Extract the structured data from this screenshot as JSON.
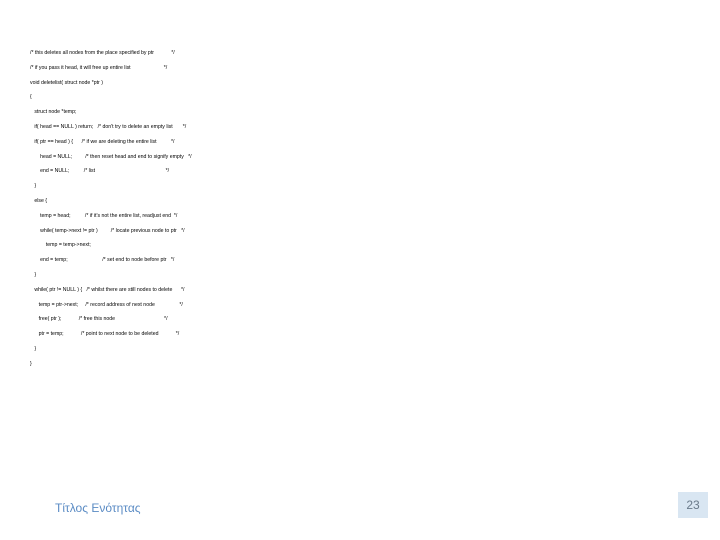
{
  "code": {
    "l1": "/* this deletes all nodes from the place specified by ptr            */",
    "l2": "/* if you pass it head, it will free up entire list                       */",
    "l3": "void deletelist( struct node *ptr )",
    "l4": "{",
    "l5": "   struct node *temp;",
    "l6": "   if( head == NULL ) return;   /* don't try to delete an empty list       */",
    "l7": "   if( ptr == head ) {      /* if we are deleting the entire list          */",
    "l8": "       head = NULL;         /* then reset head and end to signify empty   */",
    "l9": "       end = NULL;          /* list                                                 */",
    "l10": "   }",
    "l11": "   else {",
    "l12": "       temp = head;          /* if it's not the entire list, readjust end  */",
    "l13": "       while( temp->next != ptr )         /* locate previous node to ptr   */",
    "l14": "           temp = temp->next;",
    "l15": "       end = temp;                        /* set end to node before ptr   */",
    "l16": "   }",
    "l17": "   while( ptr != NULL ) {   /* whilst there are still nodes to delete      */",
    "l18": "      temp = ptr->next;     /* record address of next node                 */",
    "l19": "      free( ptr );            /* free this node                                  */",
    "l20": "      ptr = temp;            /* point to next node to be deleted            */",
    "l21": "   }",
    "l22": "}"
  },
  "footer": {
    "title": "Τίτλος Ενότητας",
    "page": "23"
  }
}
